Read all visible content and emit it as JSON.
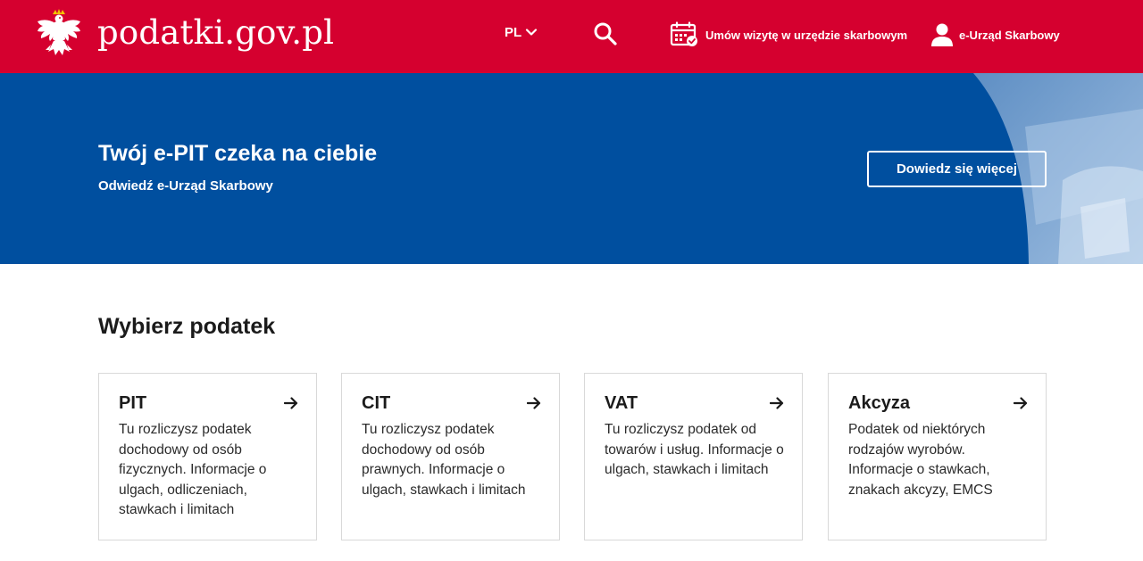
{
  "header": {
    "site_title": "podatki.gov.pl",
    "lang_label": "PL",
    "appointment_label": "Umów wizytę w urzędzie skarbowym",
    "eus_label": "e-Urząd Skarbowy",
    "bg_color": "#d5002f"
  },
  "banner": {
    "title": "Twój e-PIT czeka na ciebie",
    "subtitle": "Odwiedź e-Urząd Skarbowy",
    "button_label": "Dowiedz się więcej",
    "bg_color": "#004f9f"
  },
  "section": {
    "title": "Wybierz podatek",
    "cards": [
      {
        "title": "PIT",
        "desc": "Tu rozliczysz podatek dochodowy od osób fizycznych. Informacje o ulgach, odliczeniach, stawkach i limitach"
      },
      {
        "title": "CIT",
        "desc": "Tu rozliczysz podatek dochodowy od osób prawnych. Informacje o ulgach, stawkach i limitach"
      },
      {
        "title": "VAT",
        "desc": "Tu rozliczysz podatek od towarów i usług. Informacje o ulgach, stawkach i limitach"
      },
      {
        "title": "Akcyza",
        "desc": "Podatek od niektórych rodzajów wyrobów. Informacje o stawkach, znakach akcyzy, EMCS"
      }
    ]
  },
  "icons": {
    "logo": "white-eagle-emblem",
    "lang_chevron": "chevron-down-icon",
    "search": "search-icon",
    "appointment": "calendar-check-icon",
    "eus": "user-icon",
    "card_arrow": "arrow-right-icon"
  }
}
